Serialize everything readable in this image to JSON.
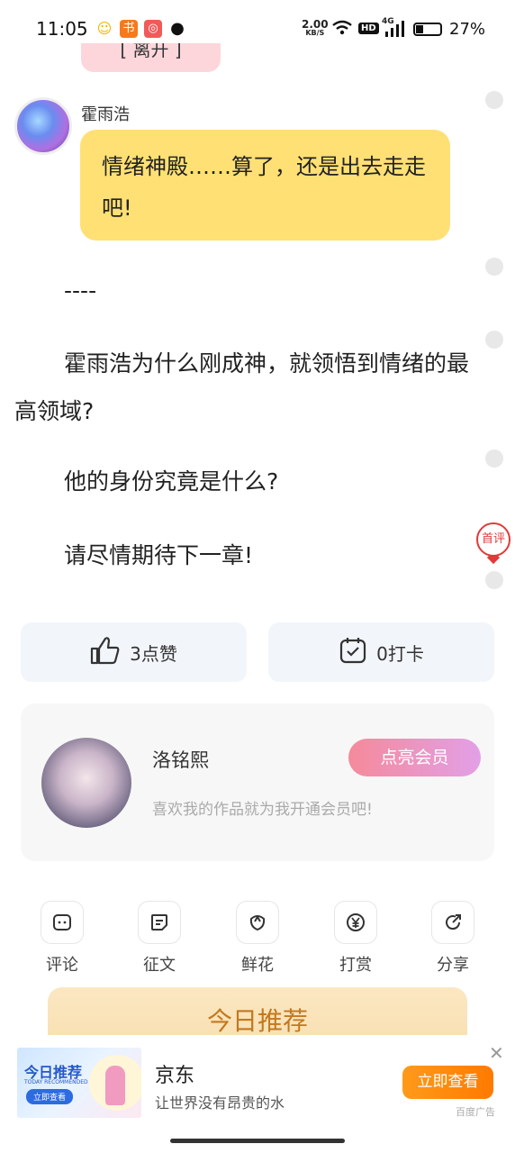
{
  "status_bar": {
    "time": "11:05",
    "net_speed": "2.00",
    "net_unit": "KB/S",
    "hd": "HD",
    "signal": "4G",
    "battery": "27%",
    "icons": [
      "assistant-icon",
      "book-app-icon",
      "game-app-icon",
      "wechat-icon"
    ]
  },
  "chat": {
    "pink_bubble_text": "[ 离开 ]",
    "sender_name": "霍雨浩",
    "message": "情绪神殿……算了，还是出去走走吧!"
  },
  "text": {
    "divider": "----",
    "para1": "霍雨浩为什么刚成神，就领悟到情绪的最高领域?",
    "para2": "他的身份究竟是什么?",
    "para3": "请尽情期待下一章!"
  },
  "badge": {
    "label": "首评",
    "color": "#e23a3a"
  },
  "actions": {
    "like": "3点赞",
    "checkin": "0打卡"
  },
  "author_card": {
    "name": "洛铭熙",
    "vip_button": "点亮会员",
    "tip": "喜欢我的作品就为我开通会员吧!"
  },
  "toolbar": [
    {
      "label": "评论",
      "icon": "comment-icon"
    },
    {
      "label": "征文",
      "icon": "essay-icon"
    },
    {
      "label": "鲜花",
      "icon": "flower-icon"
    },
    {
      "label": "打赏",
      "icon": "yen-icon"
    },
    {
      "label": "分享",
      "icon": "share-icon"
    }
  ],
  "recommend": {
    "title": "今日推荐"
  },
  "ad": {
    "image_title": "今日推荐",
    "image_sub": "TODAY RECOMMENDED",
    "image_btn": "立即查看",
    "title": "京东",
    "desc": "让世界没有昂贵的水",
    "button": "立即查看",
    "tag": "百度广告",
    "close": "✕"
  }
}
